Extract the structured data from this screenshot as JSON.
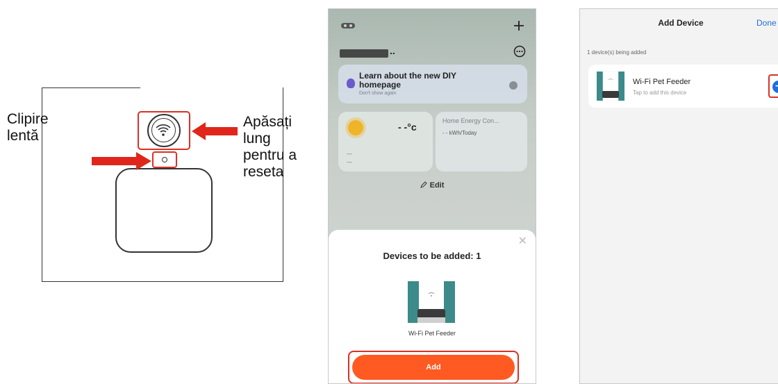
{
  "diagram": {
    "left_label": "Clipire\nlentă",
    "right_label": "Apăsați\nlung\npentru a\nreseta"
  },
  "colors": {
    "highlight": "#d93025",
    "add_button": "#ff5a22",
    "link_blue": "#1e6fd9"
  },
  "phone1": {
    "banner_title": "Learn about the new DIY homepage",
    "banner_sub": "Don't show again",
    "temperature": "- -°c",
    "weather_dash1": "---",
    "weather_dash2": "---",
    "energy_title": "Home Energy Con...",
    "energy_value": "- -  kWh/Today",
    "edit_label": "Edit",
    "sheet_title": "Devices to be added: 1",
    "device_name": "Wi-Fi Pet Feeder",
    "add_label": "Add"
  },
  "phone2": {
    "title": "Add Device",
    "done_label": "Done",
    "status": "1 device(s) being added",
    "device_name": "Wi-Fi Pet Feeder",
    "device_sub": "Tap to add this device"
  }
}
